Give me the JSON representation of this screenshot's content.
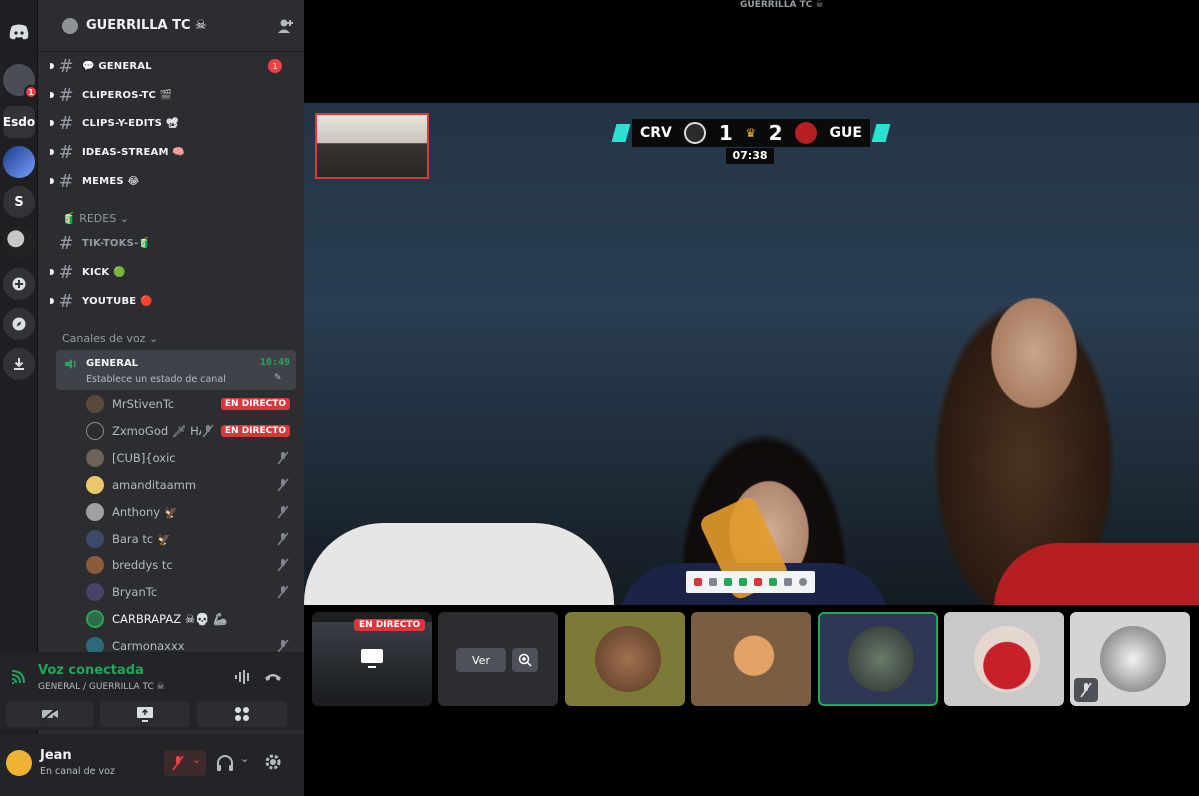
{
  "window": {
    "top_title": "GUERRILLA TC ☠"
  },
  "server": {
    "name": "GUERRILLA TC ☠",
    "invite_icon": "add-member-icon"
  },
  "rail": {
    "items": [
      {
        "label": "",
        "icon": "discord-logo-icon"
      },
      {
        "label": "",
        "badge": "1"
      },
      {
        "label": "Esdo"
      },
      {
        "label": ""
      },
      {
        "label": "S"
      },
      {
        "label": ""
      },
      {
        "label": "",
        "icon": "add-server-icon"
      },
      {
        "label": "",
        "icon": "compass-icon"
      },
      {
        "label": "",
        "icon": "download-icon"
      }
    ]
  },
  "channels": {
    "text": [
      {
        "name": "💬 GENERAL",
        "unread": "1"
      },
      {
        "name": "CLIPEROS-TC 🎬"
      },
      {
        "name": "CLIPS-Y-EDITS 📽"
      },
      {
        "name": "IDEAS-STREAM 🧠"
      },
      {
        "name": "MEMES 😂"
      }
    ],
    "redes_category": "🧃 REDES",
    "redes": [
      {
        "name": "TIK-TOKS-🧃"
      },
      {
        "name": "KICK 🟢"
      },
      {
        "name": "YOUTUBE 🔴"
      }
    ],
    "voice_category": "Canales de voz",
    "voice": {
      "name": "GENERAL",
      "time": "10:49",
      "status": "Establece un estado de canal"
    }
  },
  "voice_members": [
    {
      "name": "MrStivenTc",
      "live": "EN DIRECTO"
    },
    {
      "name": "ZxmoGod 🗡 HA",
      "live": "EN DIRECTO",
      "muted": true
    },
    {
      "name": "[CUB]{oxic",
      "muted": true
    },
    {
      "name": "amanditaamm",
      "muted": true
    },
    {
      "name": "Anthony 🦅",
      "muted": true
    },
    {
      "name": "Bara tc 🦅",
      "muted": true
    },
    {
      "name": "breddys tc",
      "muted": true
    },
    {
      "name": "BryanTc",
      "muted": true
    },
    {
      "name": "CARBRAPAZ ☠💀 🦾"
    },
    {
      "name": "Carmonaxxx",
      "muted": true
    }
  ],
  "voice_panel": {
    "title": "Voz conectada",
    "subtitle": "GENERAL / GUERRILLA TC ☠"
  },
  "user": {
    "name": "Jean",
    "status": "En canal de voz"
  },
  "stage": {
    "scoreboard": {
      "team_left": "CRV",
      "score_left": "1",
      "score_right": "2",
      "team_right": "GUE",
      "clock": "07:38"
    },
    "tiles": [
      {
        "live": "EN DIRECTO"
      },
      {
        "view_label": "Ver"
      },
      {},
      {},
      {},
      {},
      {}
    ]
  },
  "colors": {
    "accent_green": "#23a55a",
    "live_red": "#da373c",
    "unread_red": "#f23f43",
    "rail_bg": "#1e1f22",
    "sidebar_bg": "#2b2d31"
  }
}
